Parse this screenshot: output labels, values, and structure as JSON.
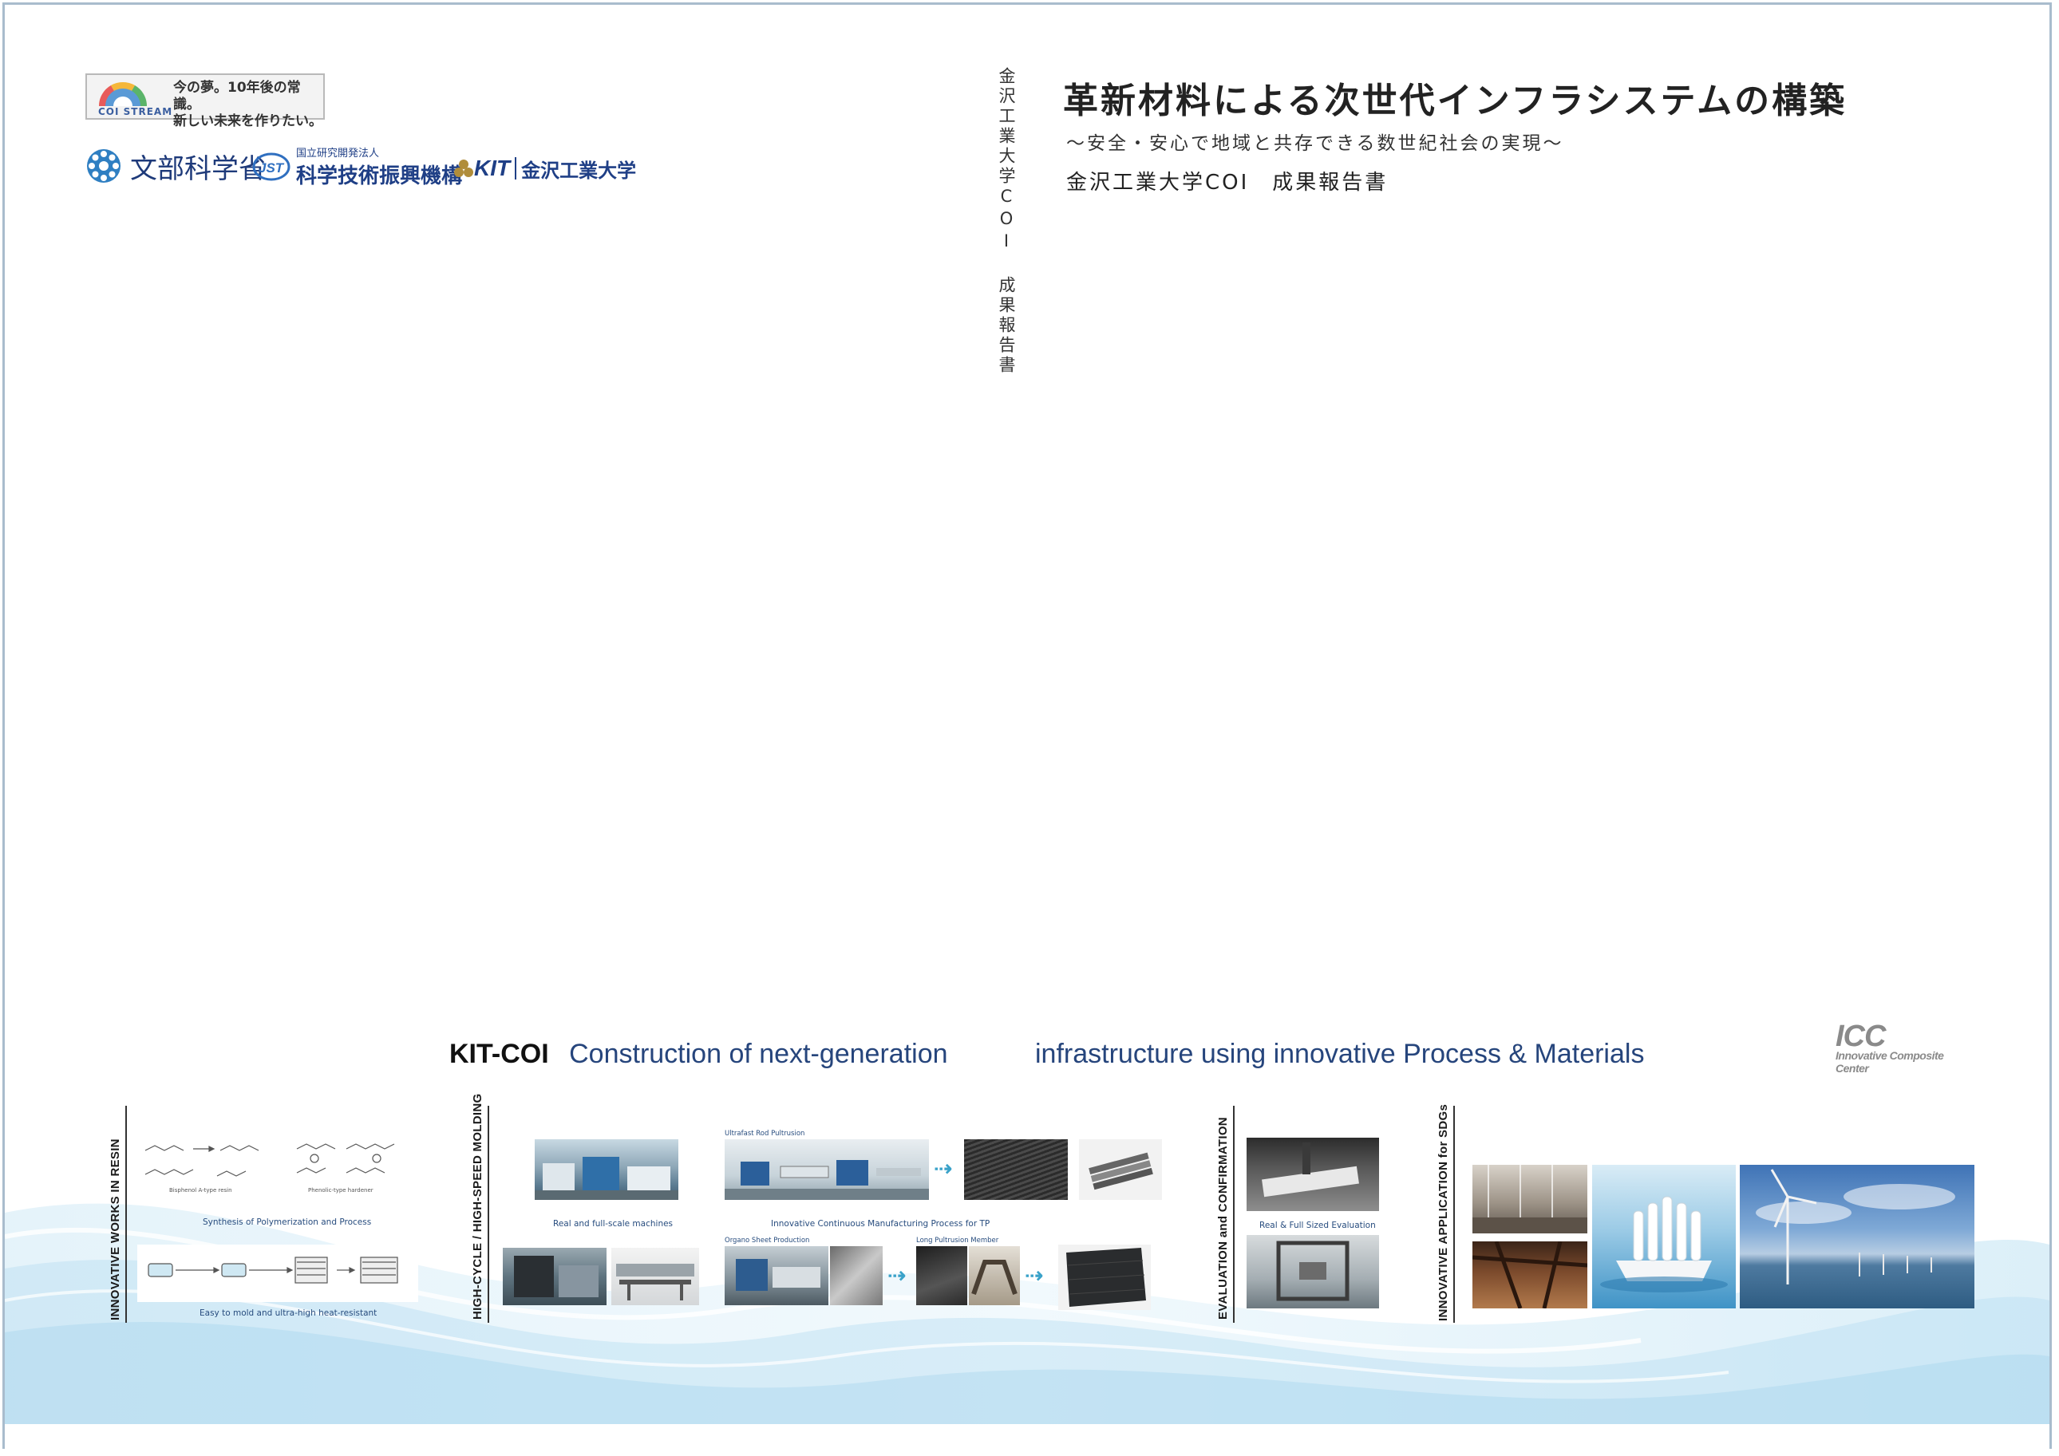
{
  "header": {
    "coi_logo": {
      "name": "COI STREAM",
      "slogan_line1": "今の夢。10年後の常識。",
      "slogan_line2": "新しい未来を作りたい。"
    },
    "mext_logo": {
      "text": "文部科学省"
    },
    "jst_logo": {
      "small": "国立研究開発法人",
      "big": "科学技術振興機構"
    },
    "kit_logo": {
      "mark": "KIT",
      "name": "金沢工業大学"
    }
  },
  "spine": {
    "text": "金沢工業大学COI 成果報告書"
  },
  "title_block": {
    "title": "革新材料による次世代インフラシステムの構築",
    "subtitle": "～安全・安心で地域と共存できる数世紀社会の実現～",
    "report": "金沢工業大学COI　成果報告書"
  },
  "banner": {
    "kit_coi": "KIT-COI",
    "title_part1": "Construction of next-generation",
    "title_part2": "infrastructure using innovative Process & Materials",
    "icc_mark": "ICC",
    "icc_sub": "Innovative Composite Center"
  },
  "sections": {
    "resin": {
      "label": "INNOVATIVE WORKS IN RESIN",
      "caption_top": "Synthesis of Polymerization and Process",
      "caption_bottom": "Easy to mold and ultra-high heat-resistant"
    },
    "molding": {
      "label": "HIGH-CYCLE / HIGH-SPEED MOLDING",
      "caption_machines": "Real and full-scale machines",
      "caption_process": "Innovative Continuous Manufacturing Process for TP",
      "small_ultrafast": "Ultrafast Rod Pultrusion",
      "small_organo": "Organo Sheet Production",
      "small_long": "Long Pultrusion Member",
      "arrow": "⇢"
    },
    "evaluation": {
      "label": "EVALUATION and CONFIRMATION",
      "caption": "Real & Full Sized Evaluation"
    },
    "sdgs": {
      "label": "INNOVATIVE APPLICATION for SDGs"
    }
  },
  "colors": {
    "navy": "#26457c",
    "accent_blue": "#3aa2c9",
    "border": "#a9bccd"
  }
}
